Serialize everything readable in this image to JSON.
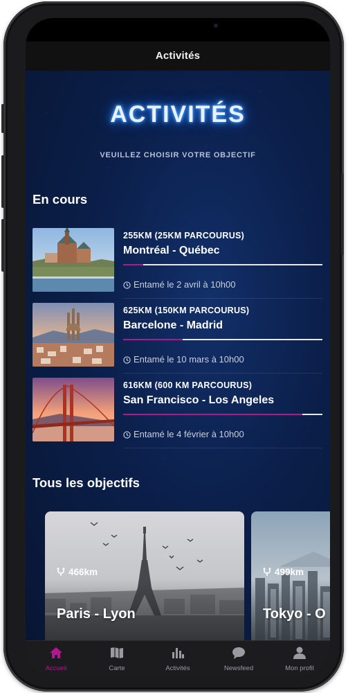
{
  "navbar": {
    "title": "Activités"
  },
  "hero": {
    "title": "ACTIVITÉS",
    "subtitle": "VEUILLEZ CHOISIR VOTRE OBJECTIF"
  },
  "ongoing": {
    "title": "En cours",
    "items": [
      {
        "distance": "255KM (25KM PARCOURUS)",
        "route": "Montréal - Québec",
        "started": "Entamé le 2 avril à 10h00",
        "progress": 0.1
      },
      {
        "distance": "625KM (150KM PARCOURUS)",
        "route": "Barcelone - Madrid",
        "started": "Entamé le 10 mars à 10h00",
        "progress": 0.3
      },
      {
        "distance": "616KM (600 KM PARCOURUS)",
        "route": "San Francisco - Los Angeles",
        "started": "Entamé le 4 février à 10h00",
        "progress": 0.9
      }
    ]
  },
  "all_goals": {
    "title": "Tous les objectifs",
    "cards": [
      {
        "km": "466km",
        "title": "Paris - Lyon"
      },
      {
        "km": "499km",
        "title": "Tokyo - O"
      }
    ]
  },
  "tabbar": {
    "items": [
      {
        "label": "Accueil",
        "icon": "home-icon",
        "active": true
      },
      {
        "label": "Carte",
        "icon": "map-icon",
        "active": false
      },
      {
        "label": "Activités",
        "icon": "bar-chart-icon",
        "active": false
      },
      {
        "label": "Newsfeed",
        "icon": "chat-bubble-icon",
        "active": false
      },
      {
        "label": "Mon profil",
        "icon": "person-icon",
        "active": false
      }
    ]
  },
  "colors": {
    "accent": "#b0198c",
    "background": "#0b1f4a",
    "neon": "#2f8dff"
  }
}
